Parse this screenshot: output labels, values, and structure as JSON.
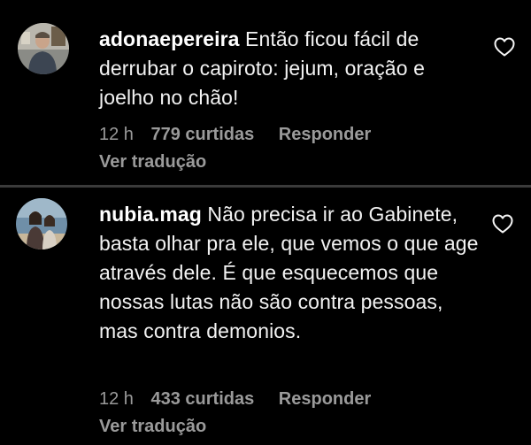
{
  "comments": [
    {
      "username": "adonaepereira",
      "text": "Então ficou fácil de derrubar o capiroto: jejum, oração e joelho no chão!",
      "time": "12 h",
      "likes": "779 curtidas",
      "reply_label": "Responder",
      "translate_label": "Ver tradução",
      "avatar_icon": "user-avatar",
      "like_icon": "heart-outline-icon"
    },
    {
      "username": "nubia.mag",
      "text": "Não precisa ir ao Gabinete, basta olhar pra ele, que vemos o que age através dele. É que esquecemos que nossas lutas não são contra pessoas, mas contra demonios.",
      "time": "12 h",
      "likes": "433 curtidas",
      "reply_label": "Responder",
      "translate_label": "Ver tradução",
      "avatar_icon": "user-avatar",
      "like_icon": "heart-outline-icon"
    }
  ],
  "colors": {
    "background": "#000000",
    "text": "#f2f2f2",
    "muted": "#9a9a9a",
    "divider": "#3a3a3a"
  }
}
